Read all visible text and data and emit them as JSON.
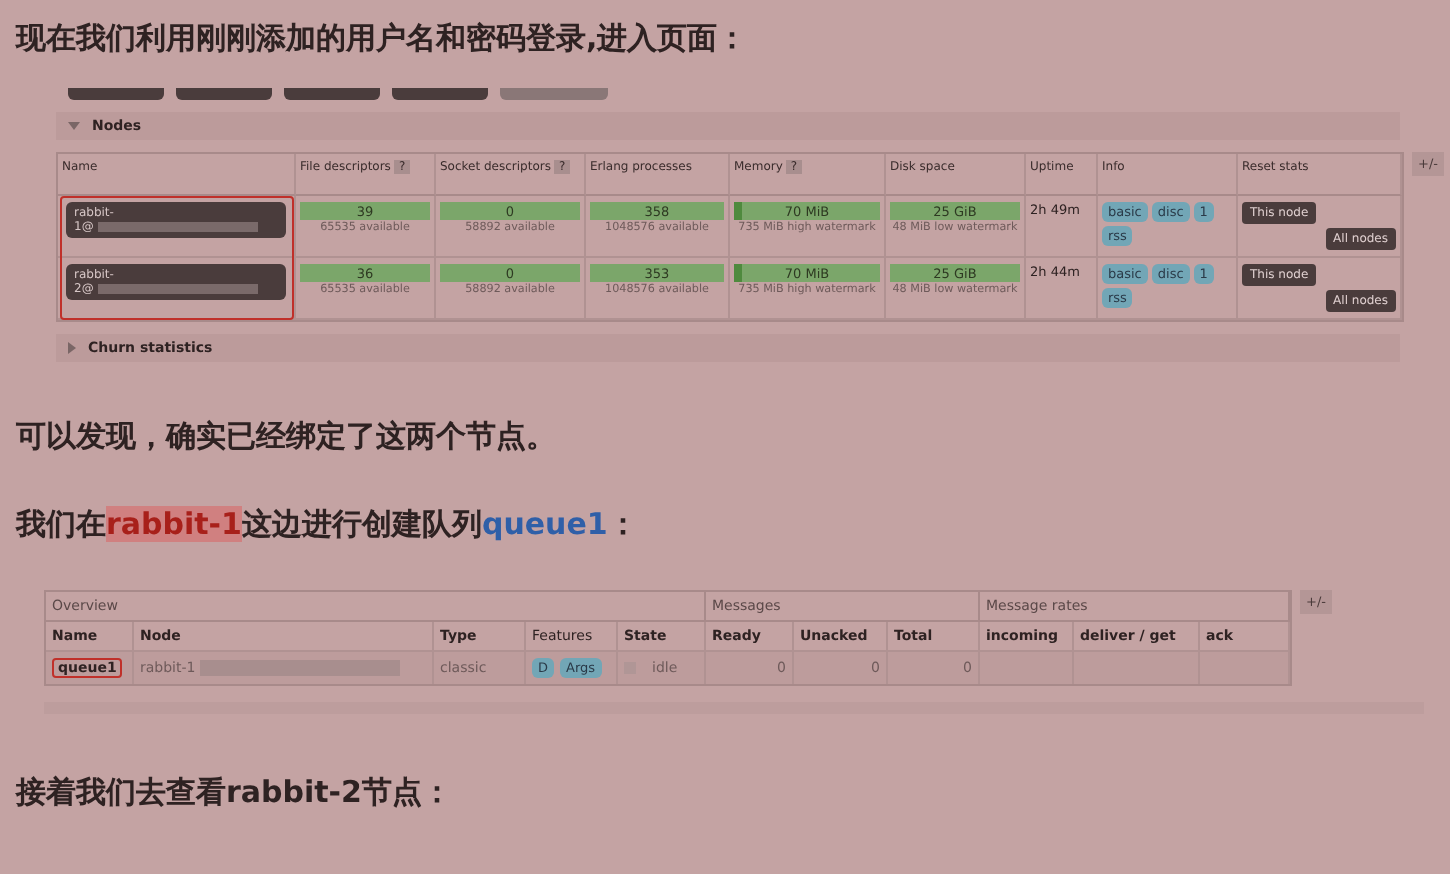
{
  "intro": "现在我们利用刚刚添加的用户名和密码登录,进入页面：",
  "nodes_screenshot": {
    "nav_tabs": [
      {
        "selected": false
      },
      {
        "selected": false
      },
      {
        "selected": false
      },
      {
        "selected": false
      },
      {
        "selected": true
      }
    ],
    "sections": [
      {
        "title": "Nodes",
        "expanded": true
      },
      {
        "title": "Churn statistics",
        "expanded": false
      }
    ],
    "columns": [
      {
        "label": "Name"
      },
      {
        "label": "File descriptors",
        "help": "?"
      },
      {
        "label": "Socket descriptors",
        "help": "?"
      },
      {
        "label": "Erlang processes"
      },
      {
        "label": "Memory",
        "help": "?"
      },
      {
        "label": "Disk space"
      },
      {
        "label": "Uptime"
      },
      {
        "label": "Info"
      },
      {
        "label": "Reset stats"
      }
    ],
    "toggle": "+/-",
    "rows": [
      {
        "name": [
          "rabbit-",
          "1@"
        ],
        "file_descriptors": {
          "value": "39",
          "sub": "65535 available"
        },
        "socket_descriptors": {
          "value": "0",
          "sub": "58892 available"
        },
        "erlang_processes": {
          "value": "358",
          "sub": "1048576 available"
        },
        "memory": {
          "value": "70 MiB",
          "level": 0.06,
          "sub": "735 MiB high watermark"
        },
        "disk": {
          "value": "25 GiB",
          "sub": "48 MiB low watermark"
        },
        "uptime": "2h 49m",
        "info": [
          "basic",
          "disc",
          "1",
          "rss"
        ],
        "reset": [
          "This node",
          "All nodes"
        ]
      },
      {
        "name": [
          "rabbit-",
          "2@"
        ],
        "file_descriptors": {
          "value": "36",
          "sub": "65535 available"
        },
        "socket_descriptors": {
          "value": "0",
          "sub": "58892 available"
        },
        "erlang_processes": {
          "value": "353",
          "sub": "1048576 available"
        },
        "memory": {
          "value": "70 MiB",
          "level": 0.06,
          "sub": "735 MiB high watermark"
        },
        "disk": {
          "value": "25 GiB",
          "sub": "48 MiB low watermark"
        },
        "uptime": "2h 44m",
        "info": [
          "basic",
          "disc",
          "1",
          "rss"
        ],
        "reset": [
          "This node",
          "All nodes"
        ]
      }
    ]
  },
  "note": "可以发现，确实已经绑定了这两个节点。",
  "queue_intro": [
    {
      "kind": "plain",
      "text": "我们在"
    },
    {
      "kind": "highlight",
      "text": "rabbit-1"
    },
    {
      "kind": "plain",
      "text": "这边进行创建队列"
    },
    {
      "kind": "accent",
      "text": "queue1"
    },
    {
      "kind": "plain",
      "text": "："
    }
  ],
  "queues_screenshot": {
    "groups": [
      {
        "label": "Overview"
      },
      {
        "label": "Messages"
      },
      {
        "label": "Message rates"
      }
    ],
    "toggle": "+/-",
    "columns": [
      {
        "label": "Name"
      },
      {
        "label": "Node"
      },
      {
        "label": "Type"
      },
      {
        "label": "Features"
      },
      {
        "label": "State"
      },
      {
        "label": "Ready"
      },
      {
        "label": "Unacked"
      },
      {
        "label": "Total"
      },
      {
        "label": "incoming"
      },
      {
        "label": "deliver / get"
      },
      {
        "label": "ack"
      }
    ],
    "rows": [
      {
        "name": "queue1",
        "node": "rabbit-1",
        "type": "classic",
        "features": [
          "D",
          "Args"
        ],
        "state": "idle",
        "ready": "0",
        "unacked": "0",
        "total": "0"
      }
    ]
  },
  "next": "接着我们去查看rabbit-2节点："
}
